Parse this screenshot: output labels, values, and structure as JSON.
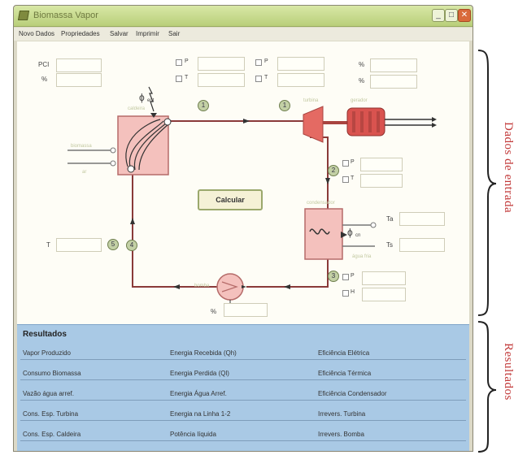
{
  "window": {
    "title": "Biomassa Vapor",
    "minimize": "_",
    "maximize": "□",
    "close": "✕"
  },
  "menu": [
    "Novo Dados",
    "Propriedades",
    "Salvar",
    "Imprimir",
    "Sair"
  ],
  "inputs": {
    "top_left": [
      "PCI",
      "%"
    ],
    "phi_label": "ϕ",
    "phi_sub": "ent",
    "gen_out": "ϕ",
    "cond_phi": "ϕ",
    "cond_phi_sub": "cn",
    "cond_t1": "Ta",
    "cond_t2": "Ts",
    "left_single": "T",
    "pump_pct": "%",
    "top_checks": [
      "P",
      "T",
      "P",
      "T"
    ],
    "right_pct": [
      "%",
      "%"
    ],
    "turbine_checks": [
      "P",
      "T"
    ],
    "bottom_checks": [
      "P",
      "H"
    ]
  },
  "badges": [
    "1",
    "1",
    "2",
    "3",
    "4",
    "5"
  ],
  "faded_labels": {
    "boiler": "caldeira",
    "turbine": "turbina",
    "generator": "gerador",
    "fuel1": "biomassa",
    "fuel2": "ar",
    "condenser": "condensador",
    "cond_out": "água fria",
    "pump": "bomba"
  },
  "calc_button": "Calcular",
  "results": {
    "title": "Resultados",
    "rows": [
      [
        "Vapor Produzido",
        "Energia Recebida (Qh)",
        "Eficiência Elétrica"
      ],
      [
        "Consumo Biomassa",
        "Energia Perdida (Ql)",
        "Eficiência Térmica"
      ],
      [
        "Vazão água arref.",
        "Energia Água Arref.",
        "Eficiência Condensador"
      ],
      [
        "Cons. Esp. Turbina",
        "Energia na Linha 1-2",
        "Irrevers. Turbina"
      ],
      [
        "Cons. Esp. Caldeira",
        "Potência líquida",
        "Irrevers. Bomba"
      ]
    ]
  },
  "annotations": {
    "inputs": "Dados de entrada",
    "results": "Resultados"
  },
  "colors": {
    "component_fill": "#f4c1bd",
    "component_stroke": "#b56b69",
    "pipe": "#8a3a3a",
    "turbine": "#e46a63",
    "annotation": "#c23a3a",
    "results_bg": "#a9c9e5"
  }
}
